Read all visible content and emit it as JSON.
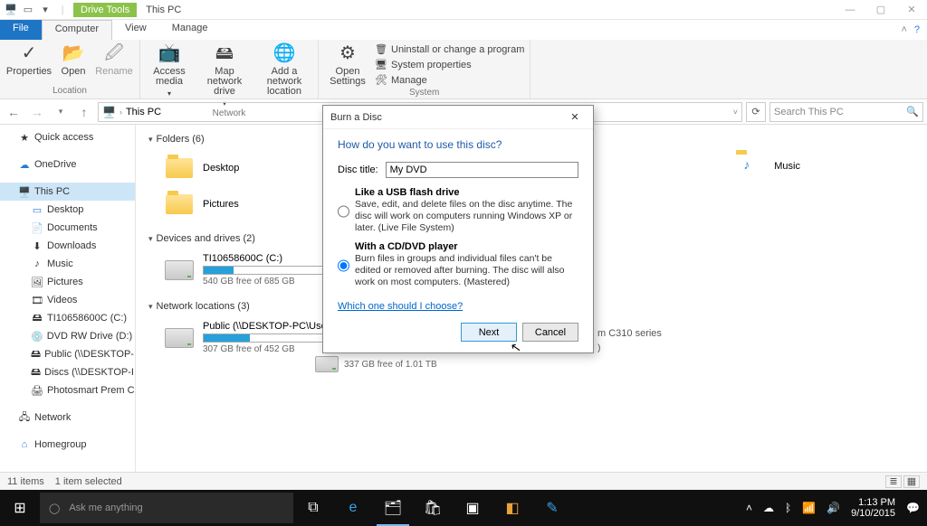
{
  "window": {
    "title": "This PC",
    "contextTab": "Drive Tools"
  },
  "tabs": {
    "file": "File",
    "computer": "Computer",
    "view": "View",
    "manage": "Manage"
  },
  "ribbon": {
    "loc": {
      "properties": "Properties",
      "open": "Open",
      "rename": "Rename",
      "label": "Location"
    },
    "net": {
      "access": "Access media",
      "map": "Map network drive",
      "add": "Add a network location",
      "label": "Network"
    },
    "sys": {
      "open": "Open Settings",
      "uninstall": "Uninstall or change a program",
      "props": "System properties",
      "manage": "Manage",
      "label": "System"
    }
  },
  "addr": {
    "loc": "This PC",
    "searchPlaceholder": "Search This PC"
  },
  "nav": {
    "quick": "Quick access",
    "onedrive": "OneDrive",
    "thispc": "This PC",
    "desktop": "Desktop",
    "documents": "Documents",
    "downloads": "Downloads",
    "music": "Music",
    "pictures": "Pictures",
    "videos": "Videos",
    "disk": "TI10658600C (C:)",
    "dvd": "DVD RW Drive (D:)",
    "public": "Public (\\\\DESKTOP-I",
    "discs": "Discs (\\\\DESKTOP-I",
    "photo": "Photosmart Prem C",
    "network": "Network",
    "homegroup": "Homegroup"
  },
  "sections": {
    "folders": "Folders (6)",
    "devices": "Devices and drives (2)",
    "netloc": "Network locations (3)"
  },
  "items": {
    "desktop": "Desktop",
    "pictures": "Pictures",
    "music": "Music",
    "c": {
      "name": "TI10658600C (C:)",
      "sub": "540 GB free of 685 GB",
      "pct": 21
    },
    "h": {
      "name": "Public (\\\\DESKTOP-PC\\Users) (H:)",
      "sub": "307 GB free of 452 GB",
      "pct": 32
    },
    "c310": "m C310 series",
    "behindFree": "337 GB free of 1.01 TB"
  },
  "status": {
    "count": "11 items",
    "sel": "1 item selected"
  },
  "dialog": {
    "title": "Burn a Disc",
    "heading": "How do you want to use this disc?",
    "discTitleLabel": "Disc title:",
    "discTitle": "My DVD",
    "opt1": {
      "title": "Like a USB flash drive",
      "desc": "Save, edit, and delete files on the disc anytime. The disc will work on computers running Windows XP or later. (Live File System)"
    },
    "opt2": {
      "title": "With a CD/DVD player",
      "desc": "Burn files in groups and individual files can't be edited or removed after burning. The disc will also work on most computers. (Mastered)"
    },
    "link": "Which one should I choose?",
    "next": "Next",
    "cancel": "Cancel"
  },
  "taskbar": {
    "cortana": "Ask me anything",
    "time": "1:13 PM",
    "date": "9/10/2015"
  }
}
